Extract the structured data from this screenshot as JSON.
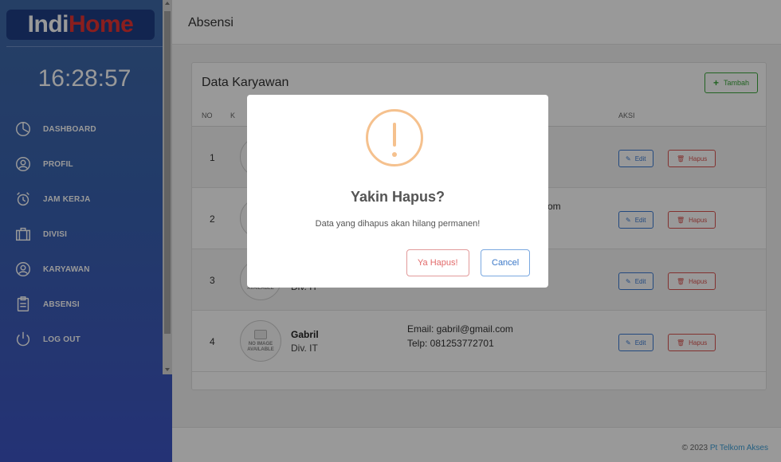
{
  "app": {
    "logo": {
      "part1": "Indi",
      "part2": "H",
      "part3": "o",
      "part4": "me"
    },
    "clock": "16:28:57"
  },
  "sidebar": {
    "items": [
      {
        "label": "DASHBOARD",
        "icon": "dashboard-icon"
      },
      {
        "label": "PROFIL",
        "icon": "profile-icon"
      },
      {
        "label": "JAM KERJA",
        "icon": "alarm-clock-icon"
      },
      {
        "label": "DIVISI",
        "icon": "briefcase-icon"
      },
      {
        "label": "KARYAWAN",
        "icon": "user-icon"
      },
      {
        "label": "ABSENSI",
        "icon": "clipboard-icon"
      },
      {
        "label": "LOG OUT",
        "icon": "power-icon"
      }
    ]
  },
  "topbar": {
    "title": "Absensi"
  },
  "card": {
    "title": "Data Karyawan",
    "add_label": "Tambah"
  },
  "table": {
    "headers": {
      "no": "NO",
      "col2": "K",
      "aksi": "AKSI"
    },
    "avatar_text": [
      "NO IMAGE",
      "AVAILABLE"
    ],
    "edit_label": "Edit",
    "delete_label": "Hapus",
    "rows": [
      {
        "no": "1",
        "name": "",
        "division": "",
        "email": "",
        "telp": ""
      },
      {
        "no": "2",
        "name": "",
        "division": "",
        "email": "om",
        "telp": ""
      },
      {
        "no": "3",
        "name": "",
        "division": "Div. IT",
        "email": "",
        "telp": ""
      },
      {
        "no": "4",
        "name": "Gabril",
        "division": "Div. IT",
        "email": "Email: gabril@gmail.com",
        "telp": "Telp: 081253772701"
      }
    ]
  },
  "footer": {
    "copyright": "© 2023 ",
    "company": "Pt Telkom Akses"
  },
  "modal": {
    "title": "Yakin Hapus?",
    "text": "Data yang dihapus akan hilang permanen!",
    "confirm_label": "Ya Hapus!",
    "cancel_label": "Cancel"
  },
  "colors": {
    "sidebar": "#3a63b0",
    "warning": "#f5c18e",
    "success": "#3aa53a",
    "danger": "#d9534f",
    "primary": "#3b7bd4"
  }
}
